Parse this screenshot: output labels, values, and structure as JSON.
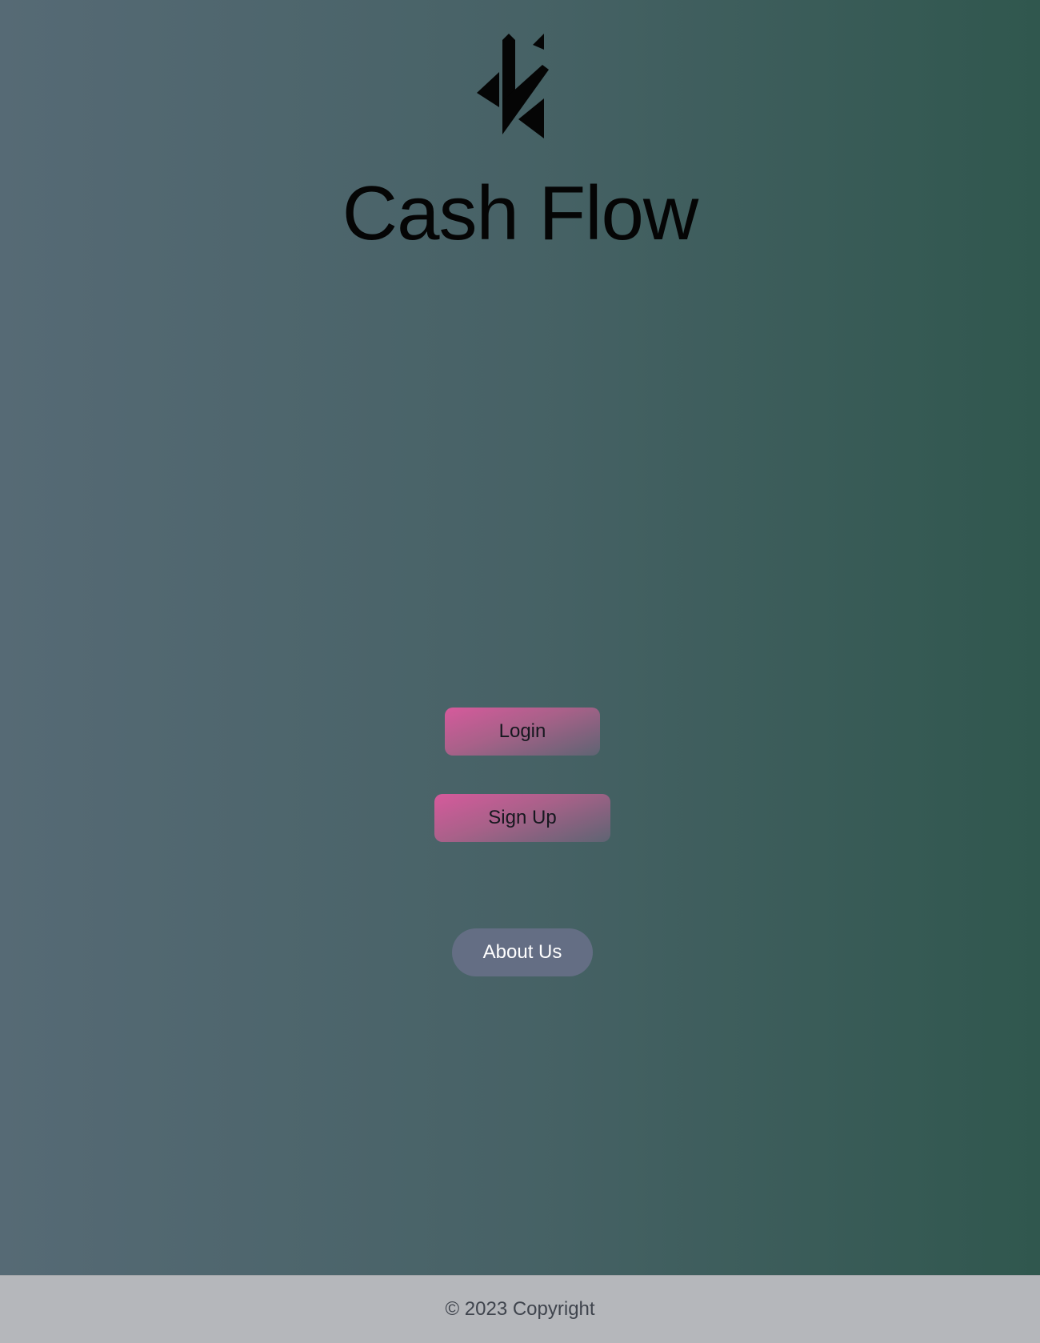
{
  "app": {
    "title": "Cash Flow",
    "logo_icon": "cash-flow-logo-icon"
  },
  "actions": {
    "login_label": "Login",
    "signup_label": "Sign Up",
    "about_label": "About Us"
  },
  "footer": {
    "copyright": "© 2023 Copyright"
  },
  "colors": {
    "background_start": "#566a75",
    "background_end": "#30574e",
    "button_pink": "#d65a9c",
    "about_button": "#646e84",
    "footer_background": "#b5b7bb"
  }
}
